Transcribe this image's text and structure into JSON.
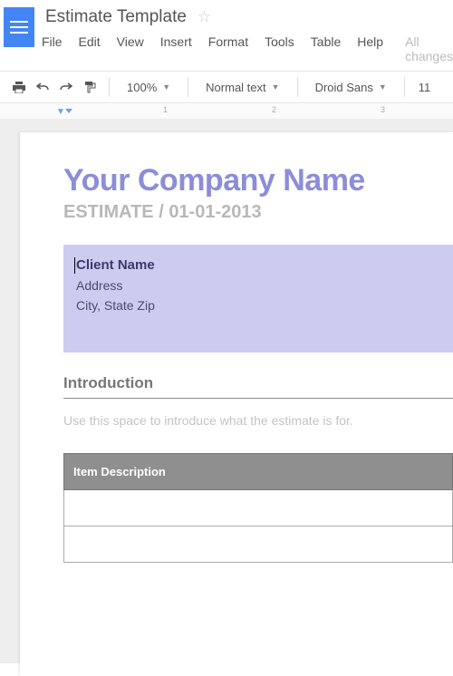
{
  "header": {
    "doc_title": "Estimate Template",
    "status": "All changes"
  },
  "menu": {
    "file": "File",
    "edit": "Edit",
    "view": "View",
    "insert": "Insert",
    "format": "Format",
    "tools": "Tools",
    "table": "Table",
    "help": "Help"
  },
  "toolbar": {
    "zoom": "100%",
    "style": "Normal text",
    "font": "Droid Sans",
    "size": "11"
  },
  "ruler": {
    "m1": "1",
    "m2": "2",
    "m3": "3"
  },
  "doc": {
    "company": "Your Company Name",
    "estimate_label": "ESTIMATE",
    "estimate_sep": " / ",
    "estimate_date": "01-01-2013",
    "client_name": "Client Name",
    "address": "Address",
    "city_state": "City, State Zip",
    "intro_heading": "Introduction",
    "intro_body": "Use this space to introduce what the estimate is for.",
    "item_desc_header": "Item Description"
  }
}
